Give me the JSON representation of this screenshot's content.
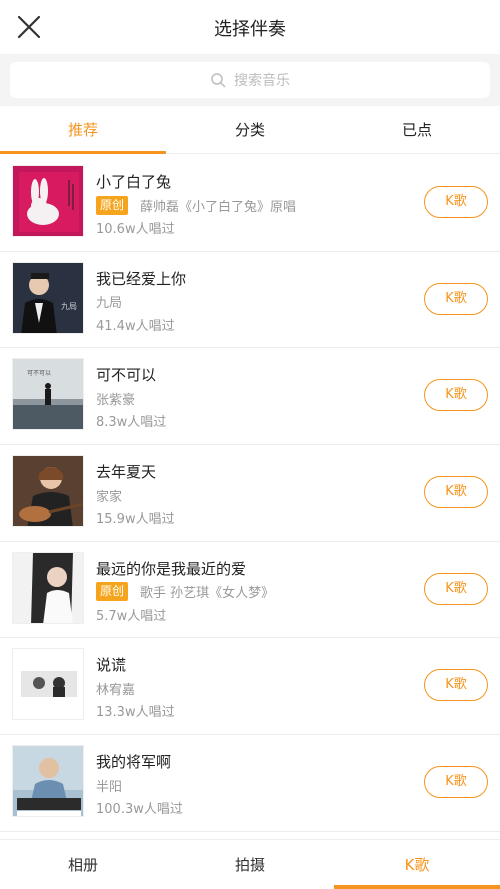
{
  "header": {
    "title": "选择伴奏",
    "close_icon": "close-icon"
  },
  "search": {
    "placeholder": "搜索音乐",
    "icon": "search-icon"
  },
  "tabs": [
    {
      "label": "推荐",
      "active": true
    },
    {
      "label": "分类",
      "active": false
    },
    {
      "label": "已点",
      "active": false
    }
  ],
  "songs": [
    {
      "title": "小了白了兔",
      "badge": "原创",
      "singer": "薛帅磊《小了白了兔》原唱",
      "plays": "10.6w人唱过",
      "button": "K歌"
    },
    {
      "title": "我已经爱上你",
      "badge": "",
      "singer": "九局",
      "plays": "41.4w人唱过",
      "button": "K歌"
    },
    {
      "title": "可不可以",
      "badge": "",
      "singer": "张紫豪",
      "plays": "8.3w人唱过",
      "button": "K歌"
    },
    {
      "title": "去年夏天",
      "badge": "",
      "singer": "家家",
      "plays": "15.9w人唱过",
      "button": "K歌"
    },
    {
      "title": "最远的你是我最近的爱",
      "badge": "原创",
      "singer": "歌手 孙艺琪《女人梦》",
      "plays": "5.7w人唱过",
      "button": "K歌"
    },
    {
      "title": "说谎",
      "badge": "",
      "singer": "林宥嘉",
      "plays": "13.3w人唱过",
      "button": "K歌"
    },
    {
      "title": "我的将军啊",
      "badge": "",
      "singer": "半阳",
      "plays": "100.3w人唱过",
      "button": "K歌"
    }
  ],
  "bottom_tabs": [
    {
      "label": "相册",
      "active": false
    },
    {
      "label": "拍摄",
      "active": false
    },
    {
      "label": "K歌",
      "active": true
    }
  ],
  "colors": {
    "accent": "#f7941d",
    "badge": "#f7a41d"
  }
}
